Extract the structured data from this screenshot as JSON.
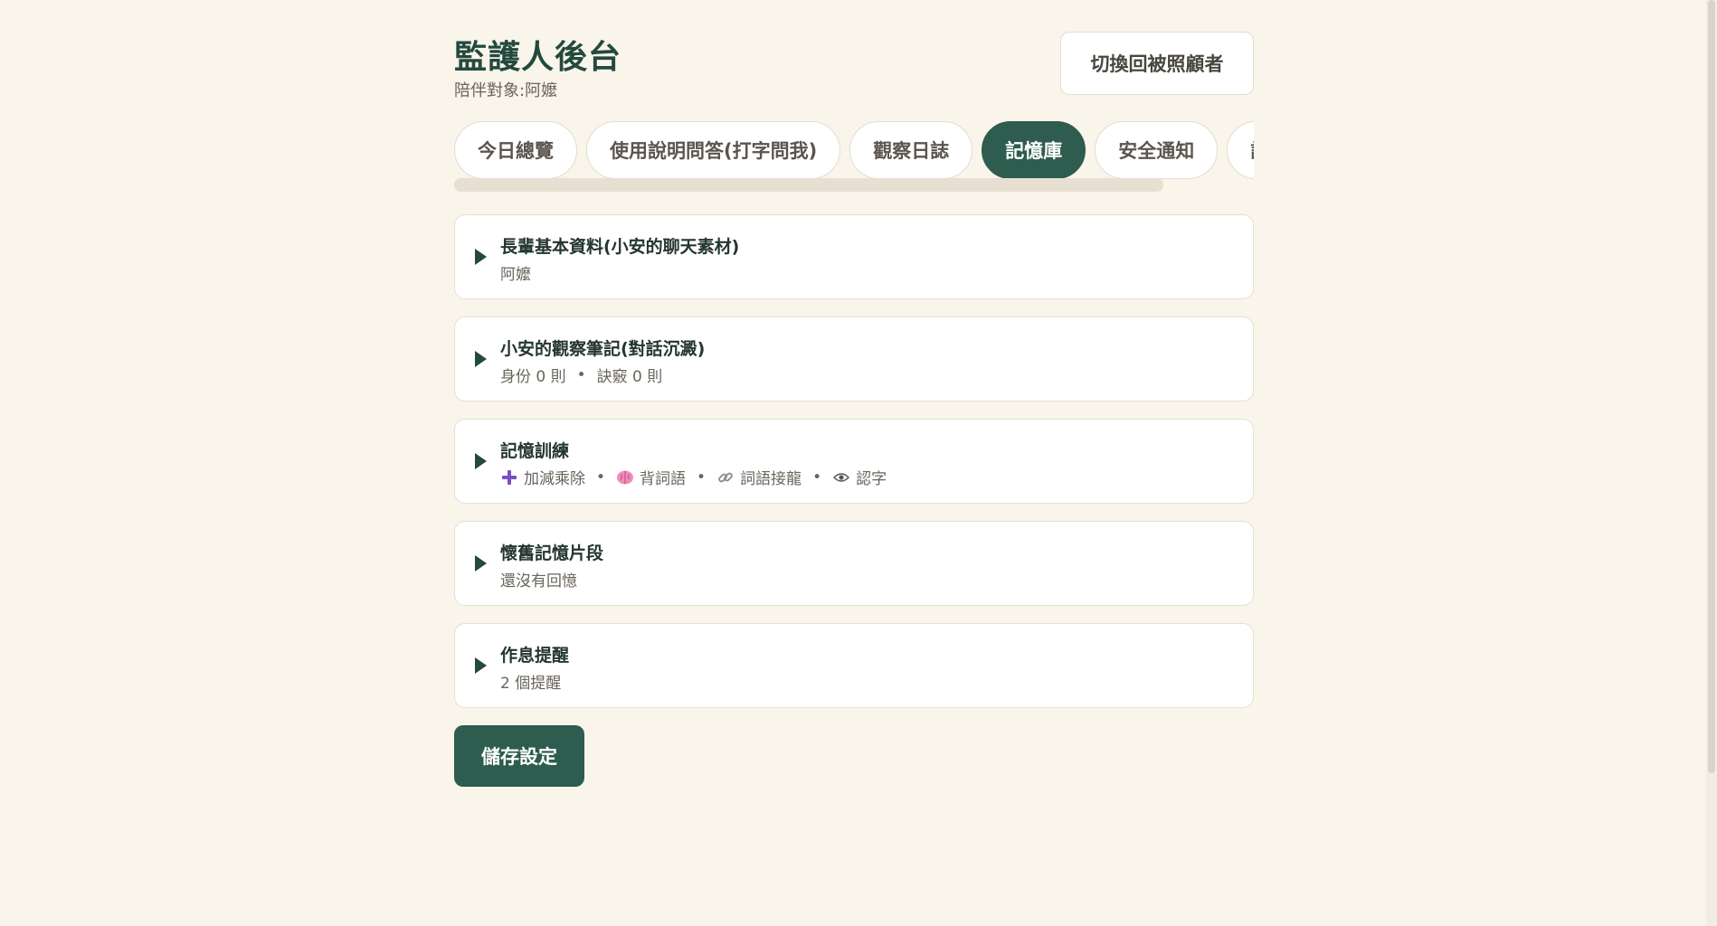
{
  "header": {
    "title": "監護人後台",
    "subtitle": "陪伴對象:阿嬤",
    "switch_label": "切換回被照顧者"
  },
  "tabs": [
    {
      "label": "今日總覽",
      "active": false
    },
    {
      "label": "使用說明問答(打字問我)",
      "active": false
    },
    {
      "label": "觀察日誌",
      "active": false
    },
    {
      "label": "記憶庫",
      "active": true
    },
    {
      "label": "安全通知",
      "active": false
    },
    {
      "label": "設",
      "active": false
    }
  ],
  "cards": [
    {
      "title": "長輩基本資料(小安的聊天素材)",
      "subtitle": "阿嬤"
    },
    {
      "title": "小安的觀察筆記(對話沉澱)",
      "subtitle_parts": [
        "身份 0 則",
        "訣竅 0 則"
      ]
    },
    {
      "title": "記憶訓練",
      "items": [
        {
          "icon": "plus-icon",
          "label": "加減乘除"
        },
        {
          "icon": "brain-icon",
          "label": "背詞語"
        },
        {
          "icon": "link-icon",
          "label": "詞語接龍"
        },
        {
          "icon": "eye-icon",
          "label": "認字"
        }
      ]
    },
    {
      "title": "懷舊記憶片段",
      "subtitle": "還沒有回憶"
    },
    {
      "title": "作息提醒",
      "subtitle": "2 個提醒"
    }
  ],
  "save_label": "儲存設定",
  "colors": {
    "background": "#f9f5eb",
    "accent": "#2e5c4e",
    "title": "#24493e"
  }
}
